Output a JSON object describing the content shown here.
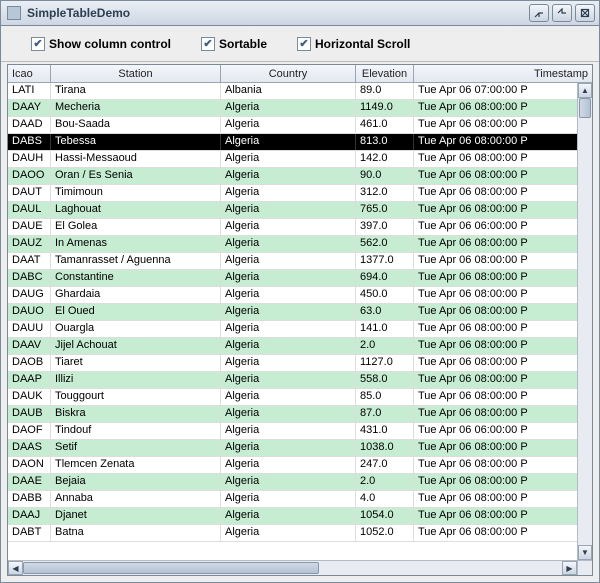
{
  "window": {
    "title": "SimpleTableDemo"
  },
  "toolbar": {
    "show_column_control": "Show column control",
    "sortable": "Sortable",
    "horizontal_scroll": "Horizontal Scroll"
  },
  "columns": [
    {
      "key": "icao",
      "label": "Icao"
    },
    {
      "key": "station",
      "label": "Station"
    },
    {
      "key": "country",
      "label": "Country"
    },
    {
      "key": "elevation",
      "label": "Elevation"
    },
    {
      "key": "timestamp",
      "label": "Timestamp"
    }
  ],
  "selected_index": 3,
  "rows": [
    {
      "icao": "LATI",
      "station": "Tirana",
      "country": "Albania",
      "elevation": "89.0",
      "timestamp": "Tue Apr 06 07:00:00 P"
    },
    {
      "icao": "DAAY",
      "station": "Mecheria",
      "country": "Algeria",
      "elevation": "1149.0",
      "timestamp": "Tue Apr 06 08:00:00 P"
    },
    {
      "icao": "DAAD",
      "station": "Bou-Saada",
      "country": "Algeria",
      "elevation": "461.0",
      "timestamp": "Tue Apr 06 08:00:00 P"
    },
    {
      "icao": "DABS",
      "station": "Tebessa",
      "country": "Algeria",
      "elevation": "813.0",
      "timestamp": "Tue Apr 06 08:00:00 P"
    },
    {
      "icao": "DAUH",
      "station": "Hassi-Messaoud",
      "country": "Algeria",
      "elevation": "142.0",
      "timestamp": "Tue Apr 06 08:00:00 P"
    },
    {
      "icao": "DAOO",
      "station": "Oran / Es Senia",
      "country": "Algeria",
      "elevation": "90.0",
      "timestamp": "Tue Apr 06 08:00:00 P"
    },
    {
      "icao": "DAUT",
      "station": "Timimoun",
      "country": "Algeria",
      "elevation": "312.0",
      "timestamp": "Tue Apr 06 08:00:00 P"
    },
    {
      "icao": "DAUL",
      "station": "Laghouat",
      "country": "Algeria",
      "elevation": "765.0",
      "timestamp": "Tue Apr 06 08:00:00 P"
    },
    {
      "icao": "DAUE",
      "station": "El Golea",
      "country": "Algeria",
      "elevation": "397.0",
      "timestamp": "Tue Apr 06 06:00:00 P"
    },
    {
      "icao": "DAUZ",
      "station": "In Amenas",
      "country": "Algeria",
      "elevation": "562.0",
      "timestamp": "Tue Apr 06 08:00:00 P"
    },
    {
      "icao": "DAAT",
      "station": "Tamanrasset / Aguenna",
      "country": "Algeria",
      "elevation": "1377.0",
      "timestamp": "Tue Apr 06 08:00:00 P"
    },
    {
      "icao": "DABC",
      "station": "Constantine",
      "country": "Algeria",
      "elevation": "694.0",
      "timestamp": "Tue Apr 06 08:00:00 P"
    },
    {
      "icao": "DAUG",
      "station": "Ghardaia",
      "country": "Algeria",
      "elevation": "450.0",
      "timestamp": "Tue Apr 06 08:00:00 P"
    },
    {
      "icao": "DAUO",
      "station": "El Oued",
      "country": "Algeria",
      "elevation": "63.0",
      "timestamp": "Tue Apr 06 08:00:00 P"
    },
    {
      "icao": "DAUU",
      "station": "Ouargla",
      "country": "Algeria",
      "elevation": "141.0",
      "timestamp": "Tue Apr 06 08:00:00 P"
    },
    {
      "icao": "DAAV",
      "station": "Jijel Achouat",
      "country": "Algeria",
      "elevation": "2.0",
      "timestamp": "Tue Apr 06 08:00:00 P"
    },
    {
      "icao": "DAOB",
      "station": "Tiaret",
      "country": "Algeria",
      "elevation": "1127.0",
      "timestamp": "Tue Apr 06 08:00:00 P"
    },
    {
      "icao": "DAAP",
      "station": "Illizi",
      "country": "Algeria",
      "elevation": "558.0",
      "timestamp": "Tue Apr 06 08:00:00 P"
    },
    {
      "icao": "DAUK",
      "station": "Touggourt",
      "country": "Algeria",
      "elevation": "85.0",
      "timestamp": "Tue Apr 06 08:00:00 P"
    },
    {
      "icao": "DAUB",
      "station": "Biskra",
      "country": "Algeria",
      "elevation": "87.0",
      "timestamp": "Tue Apr 06 08:00:00 P"
    },
    {
      "icao": "DAOF",
      "station": "Tindouf",
      "country": "Algeria",
      "elevation": "431.0",
      "timestamp": "Tue Apr 06 06:00:00 P"
    },
    {
      "icao": "DAAS",
      "station": "Setif",
      "country": "Algeria",
      "elevation": "1038.0",
      "timestamp": "Tue Apr 06 08:00:00 P"
    },
    {
      "icao": "DAON",
      "station": "Tlemcen Zenata",
      "country": "Algeria",
      "elevation": "247.0",
      "timestamp": "Tue Apr 06 08:00:00 P"
    },
    {
      "icao": "DAAE",
      "station": "Bejaia",
      "country": "Algeria",
      "elevation": "2.0",
      "timestamp": "Tue Apr 06 08:00:00 P"
    },
    {
      "icao": "DABB",
      "station": "Annaba",
      "country": "Algeria",
      "elevation": "4.0",
      "timestamp": "Tue Apr 06 08:00:00 P"
    },
    {
      "icao": "DAAJ",
      "station": "Djanet",
      "country": "Algeria",
      "elevation": "1054.0",
      "timestamp": "Tue Apr 06 08:00:00 P"
    },
    {
      "icao": "DABT",
      "station": "Batna",
      "country": "Algeria",
      "elevation": "1052.0",
      "timestamp": "Tue Apr 06 08:00:00 P"
    }
  ]
}
